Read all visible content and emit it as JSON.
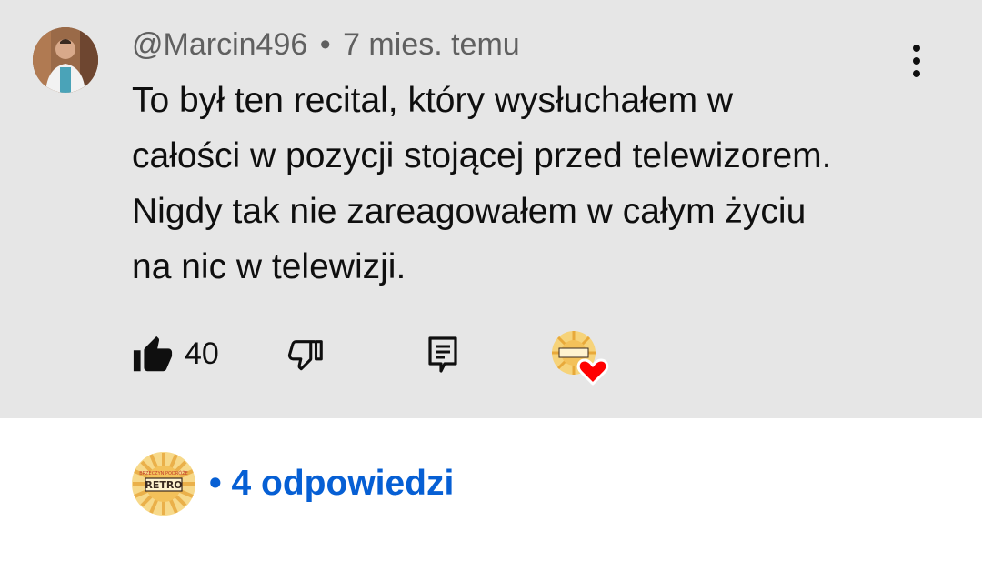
{
  "comment": {
    "author": "@Marcin496",
    "separator": "•",
    "time_ago": "7 mies. temu",
    "lines": [
      "To był ten recital, który wysłuchałem w",
      "całości w pozycji stojącej przed telewizorem.",
      "Nigdy tak nie zareagowałem w całym życiu",
      "na nic w telewizji."
    ],
    "like_count": "40",
    "icons": {
      "author_avatar": "avatar",
      "more": "more-vert-icon",
      "like": "thumb-up-filled-icon",
      "dislike": "thumb-down-outline-icon",
      "reply": "comment-icon",
      "creator_heart": "creator-heart-icon"
    }
  },
  "channel": {
    "logo_top_text": "BRZECZYN PODRÓŻE",
    "logo_main_text": "RETRO"
  },
  "replies": {
    "separator": "•",
    "label": "4 odpowiedzi"
  },
  "colors": {
    "comment_bg": "#e6e6e6",
    "link_blue": "#065fd4",
    "heart_red": "#ff0000",
    "logo_gold": "#f3c15a"
  }
}
